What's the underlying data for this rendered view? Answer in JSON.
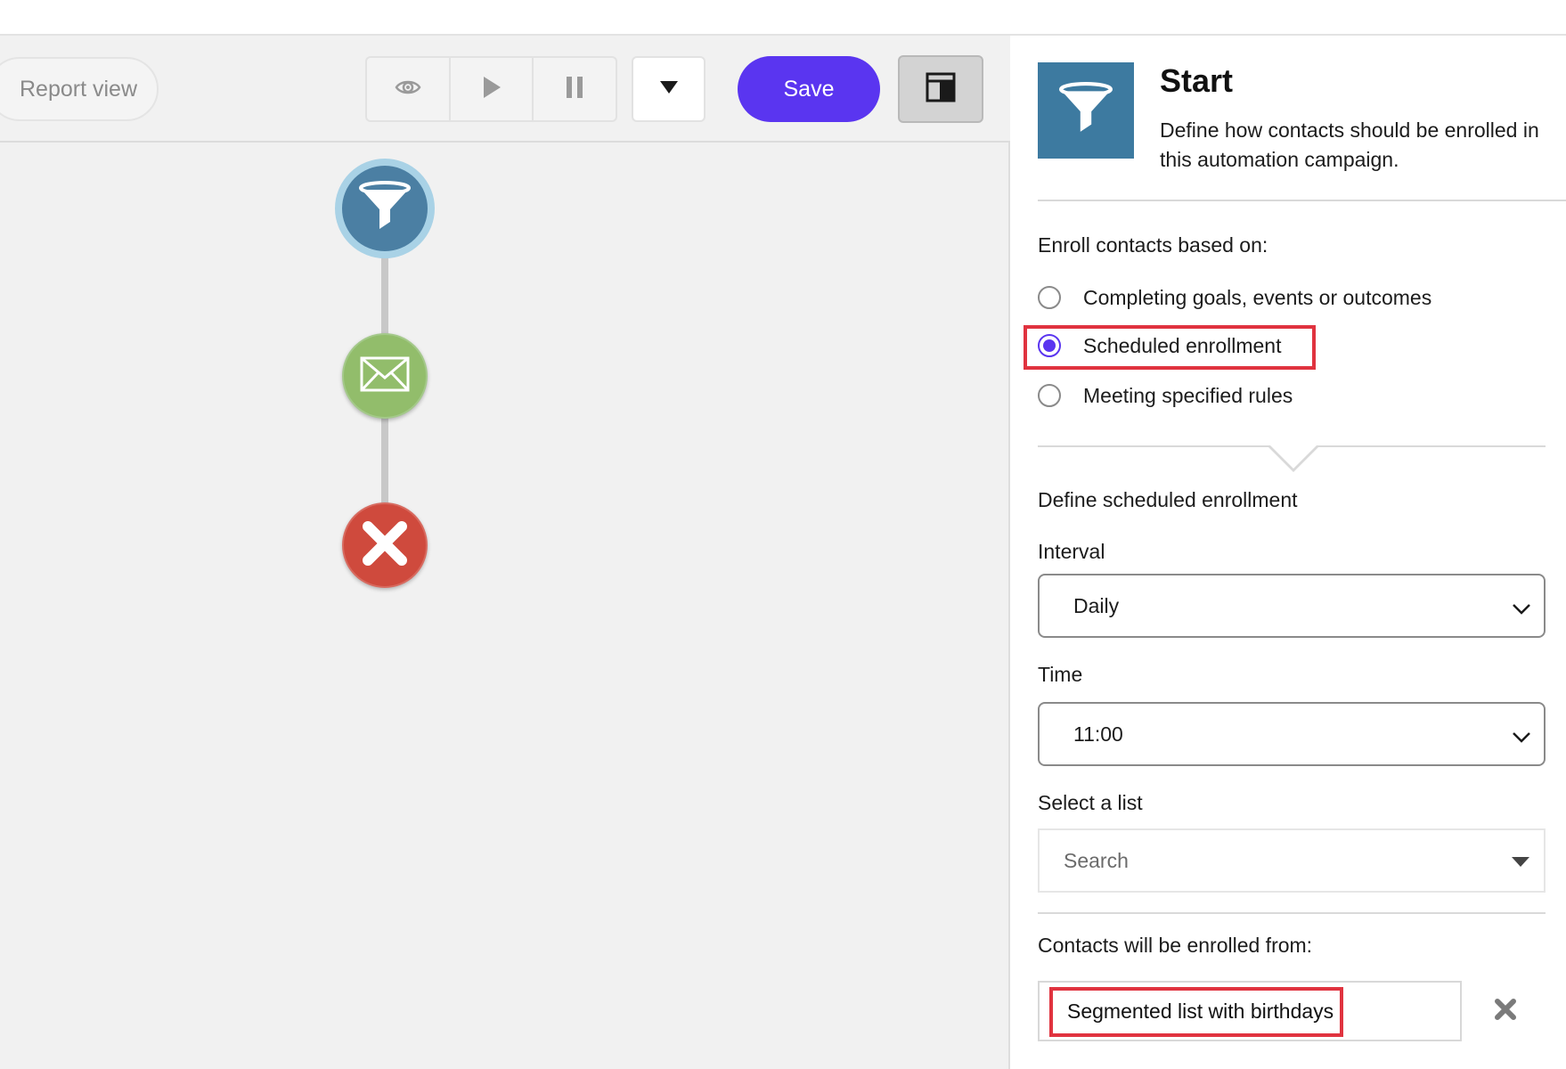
{
  "toolbar": {
    "report_view_label": "Report view",
    "save_label": "Save",
    "preview_icon": "eye-icon",
    "play_icon": "play-icon",
    "pause_icon": "pause-icon",
    "more_icon": "caret-down-icon",
    "layout_icon": "panel-layout-icon"
  },
  "flow": {
    "nodes": [
      {
        "type": "start",
        "icon": "funnel-icon",
        "color": "#4b7fa3"
      },
      {
        "type": "email",
        "icon": "envelope-icon",
        "color": "#92bd6b"
      },
      {
        "type": "exit",
        "icon": "x-icon",
        "color": "#cf4a3d"
      }
    ]
  },
  "panel": {
    "title": "Start",
    "description": "Define how contacts should be enrolled in this automation campaign.",
    "enroll_label": "Enroll contacts based on:",
    "options": [
      {
        "label": "Completing goals, events or outcomes",
        "checked": false
      },
      {
        "label": "Scheduled enrollment",
        "checked": true
      },
      {
        "label": "Meeting specified rules",
        "checked": false
      }
    ],
    "schedule_heading": "Define scheduled enrollment",
    "interval_label": "Interval",
    "interval_value": "Daily",
    "time_label": "Time",
    "time_value": "11:00",
    "list_label": "Select a list",
    "list_placeholder": "Search",
    "enrolled_from_label": "Contacts will be enrolled from:",
    "enrolled_from_value": "Segmented list with birthdays"
  },
  "colors": {
    "accent": "#5a35f0",
    "highlight": "#e0333f",
    "start_node": "#4b7fa3",
    "email_node": "#92bd6b",
    "exit_node": "#cf4a3d"
  }
}
